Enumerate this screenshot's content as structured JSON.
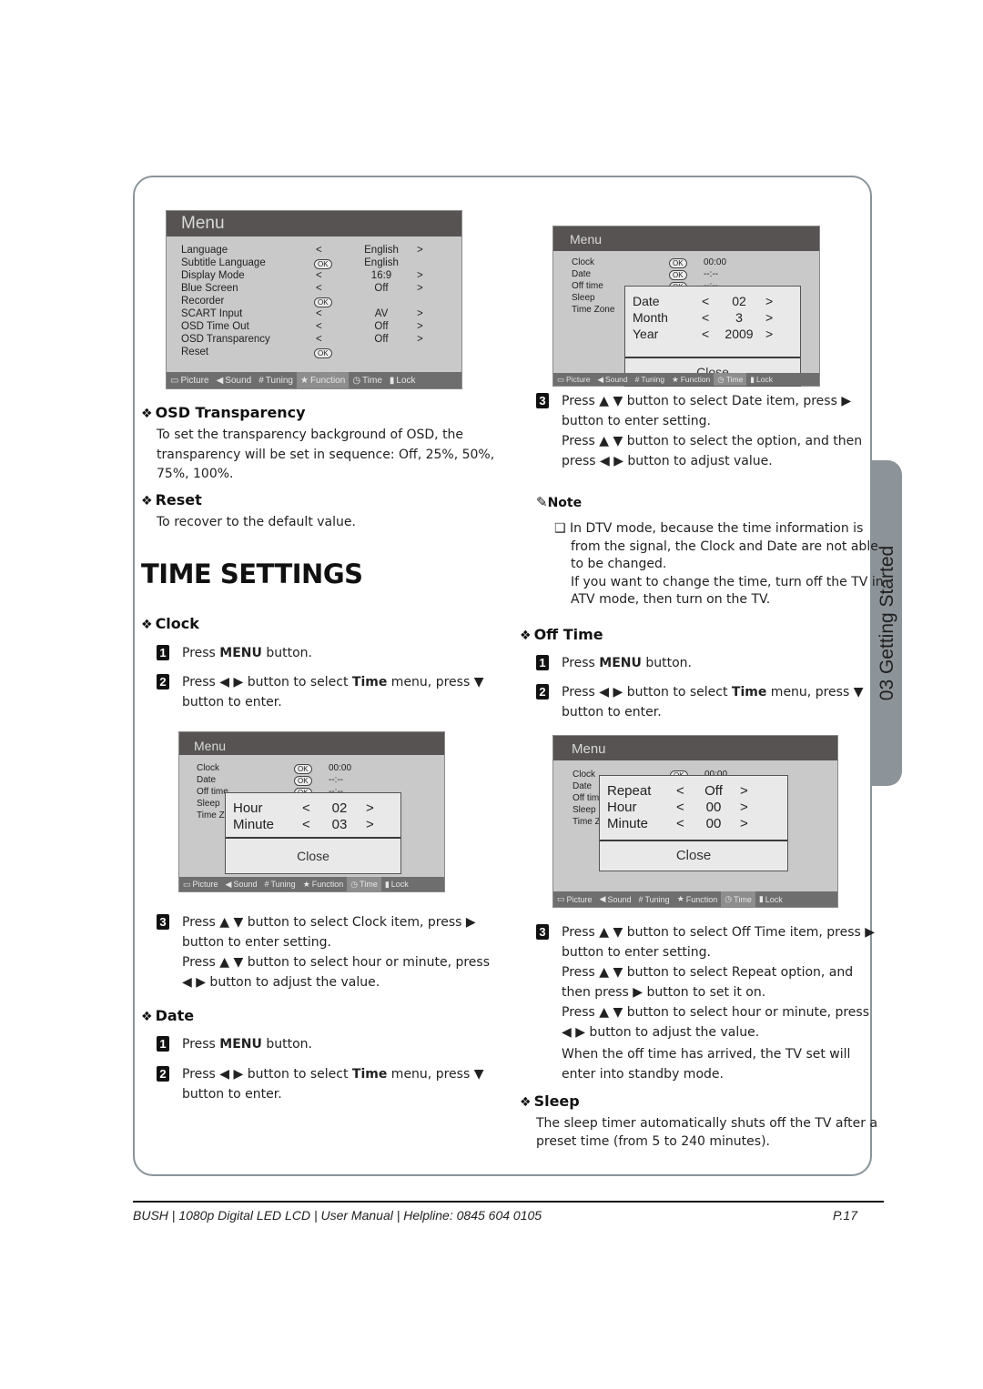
{
  "side_tab": "03 Getting Started",
  "footer": {
    "text": "BUSH  | 1080p  Digital LED LCD | User Manual | Helpline: 0845 604 0105",
    "page": "P.17"
  },
  "osd_tabs": [
    "Picture",
    "Sound",
    "Tuning",
    "Function",
    "Time",
    "Lock"
  ],
  "function_menu": {
    "title": "Menu",
    "active_tab": "Function",
    "rows": [
      {
        "label": "Language",
        "left": "<",
        "value": "English",
        "right": ">"
      },
      {
        "label": "Subtitle Language",
        "left": "OK",
        "value": "English",
        "right": ""
      },
      {
        "label": "Display Mode",
        "left": "<",
        "value": "16:9",
        "right": ">"
      },
      {
        "label": "Blue Screen",
        "left": "<",
        "value": "Off",
        "right": ">"
      },
      {
        "label": "Recorder",
        "left": "OK",
        "value": "",
        "right": ""
      },
      {
        "label": "SCART Input",
        "left": "<",
        "value": "AV",
        "right": ">"
      },
      {
        "label": "OSD Time Out",
        "left": "<",
        "value": "Off",
        "right": ">"
      },
      {
        "label": "OSD Transparency",
        "left": "<",
        "value": "Off",
        "right": ">"
      },
      {
        "label": "Reset",
        "left": "OK",
        "value": "",
        "right": ""
      }
    ]
  },
  "time_menu_rows": [
    {
      "label": "Clock",
      "ok": "OK",
      "value": "00:00"
    },
    {
      "label": "Date",
      "ok": "OK",
      "value": "--:--"
    },
    {
      "label": "Off time",
      "ok": "OK",
      "value": "--:--"
    },
    {
      "label": "Sleep",
      "ok": "",
      "value": ""
    },
    {
      "label": "Time Zone",
      "ok": "",
      "value": ""
    }
  ],
  "date_popup": {
    "rows": [
      {
        "label": "Date",
        "value": "02"
      },
      {
        "label": "Month",
        "value": "3"
      },
      {
        "label": "Year",
        "value": "2009"
      }
    ],
    "close": "Close"
  },
  "clock_popup": {
    "rows": [
      {
        "label": "Hour",
        "value": "02"
      },
      {
        "label": "Minute",
        "value": "03"
      }
    ],
    "close": "Close"
  },
  "offtime_popup": {
    "rows": [
      {
        "label": "Repeat",
        "value": "Off"
      },
      {
        "label": "Hour",
        "value": "00"
      },
      {
        "label": "Minute",
        "value": "00"
      }
    ],
    "close": "Close"
  },
  "left": {
    "osd_transparency": {
      "heading": "OSD Transparency",
      "body": [
        "To set the transparency background of OSD, the",
        "transparency will be set in sequence: Off, 25%, 50%,",
        "75%, 100%."
      ]
    },
    "reset": {
      "heading": "Reset",
      "body": "To recover to the default value."
    },
    "title": "TIME SETTINGS",
    "clock": {
      "heading": "Clock",
      "step1": {
        "num": "1",
        "pre": "Press ",
        "bold": "MENU",
        "post": " button."
      },
      "step2": {
        "num": "2",
        "line1_pre": "Press ◀ ▶ button to select ",
        "bold": "Time",
        "line1_post": " menu, press ▼",
        "line2": "button to enter."
      },
      "step3": {
        "num": "3",
        "lines": [
          "Press ▲ ▼ button to select Clock item, press ▶",
          "button to enter setting.",
          "Press ▲ ▼ button to select hour or minute, press",
          "◀ ▶ button to adjust the value."
        ]
      }
    },
    "date": {
      "heading": "Date",
      "step1": {
        "num": "1",
        "pre": "Press ",
        "bold": "MENU",
        "post": " button."
      },
      "step2": {
        "num": "2",
        "line1_pre": "Press ◀ ▶ button to select ",
        "bold": "Time",
        "line1_post": " menu, press ▼",
        "line2": "button to enter."
      }
    }
  },
  "right": {
    "date_step3": {
      "num": "3",
      "lines": [
        "Press ▲ ▼ button to select Date item, press ▶",
        "button to enter setting.",
        "Press ▲ ▼ button to select the option, and then",
        "press ◀ ▶ button to adjust value."
      ]
    },
    "note": {
      "heading": "Note",
      "lines": [
        "❑ In DTV mode, because the time information is",
        "from the signal, the Clock and Date are not able",
        "to be changed.",
        "If you want to change the time, turn off the TV in",
        "ATV mode, then turn on the TV."
      ]
    },
    "off_time": {
      "heading": "Off Time",
      "step1": {
        "num": "1",
        "pre": "Press ",
        "bold": "MENU",
        "post": " button."
      },
      "step2": {
        "num": "2",
        "line1_pre": "Press ◀ ▶ button to select ",
        "bold": "Time",
        "line1_post": " menu, press ▼",
        "line2": "button to enter."
      },
      "step3": {
        "num": "3",
        "lines": [
          "Press ▲ ▼ button to select Off Time item, press ▶",
          "button to enter setting.",
          "Press ▲ ▼ button to select Repeat option, and",
          "then press ▶ button to set it on.",
          "Press ▲ ▼ button to select hour or minute, press",
          "◀ ▶ button to adjust the value.",
          "When the off time has arrived, the TV set will",
          "enter into standby mode."
        ]
      }
    },
    "sleep": {
      "heading": "Sleep",
      "body": [
        "The sleep timer automatically shuts off the TV after a",
        "preset time (from 5 to 240 minutes)."
      ]
    }
  }
}
